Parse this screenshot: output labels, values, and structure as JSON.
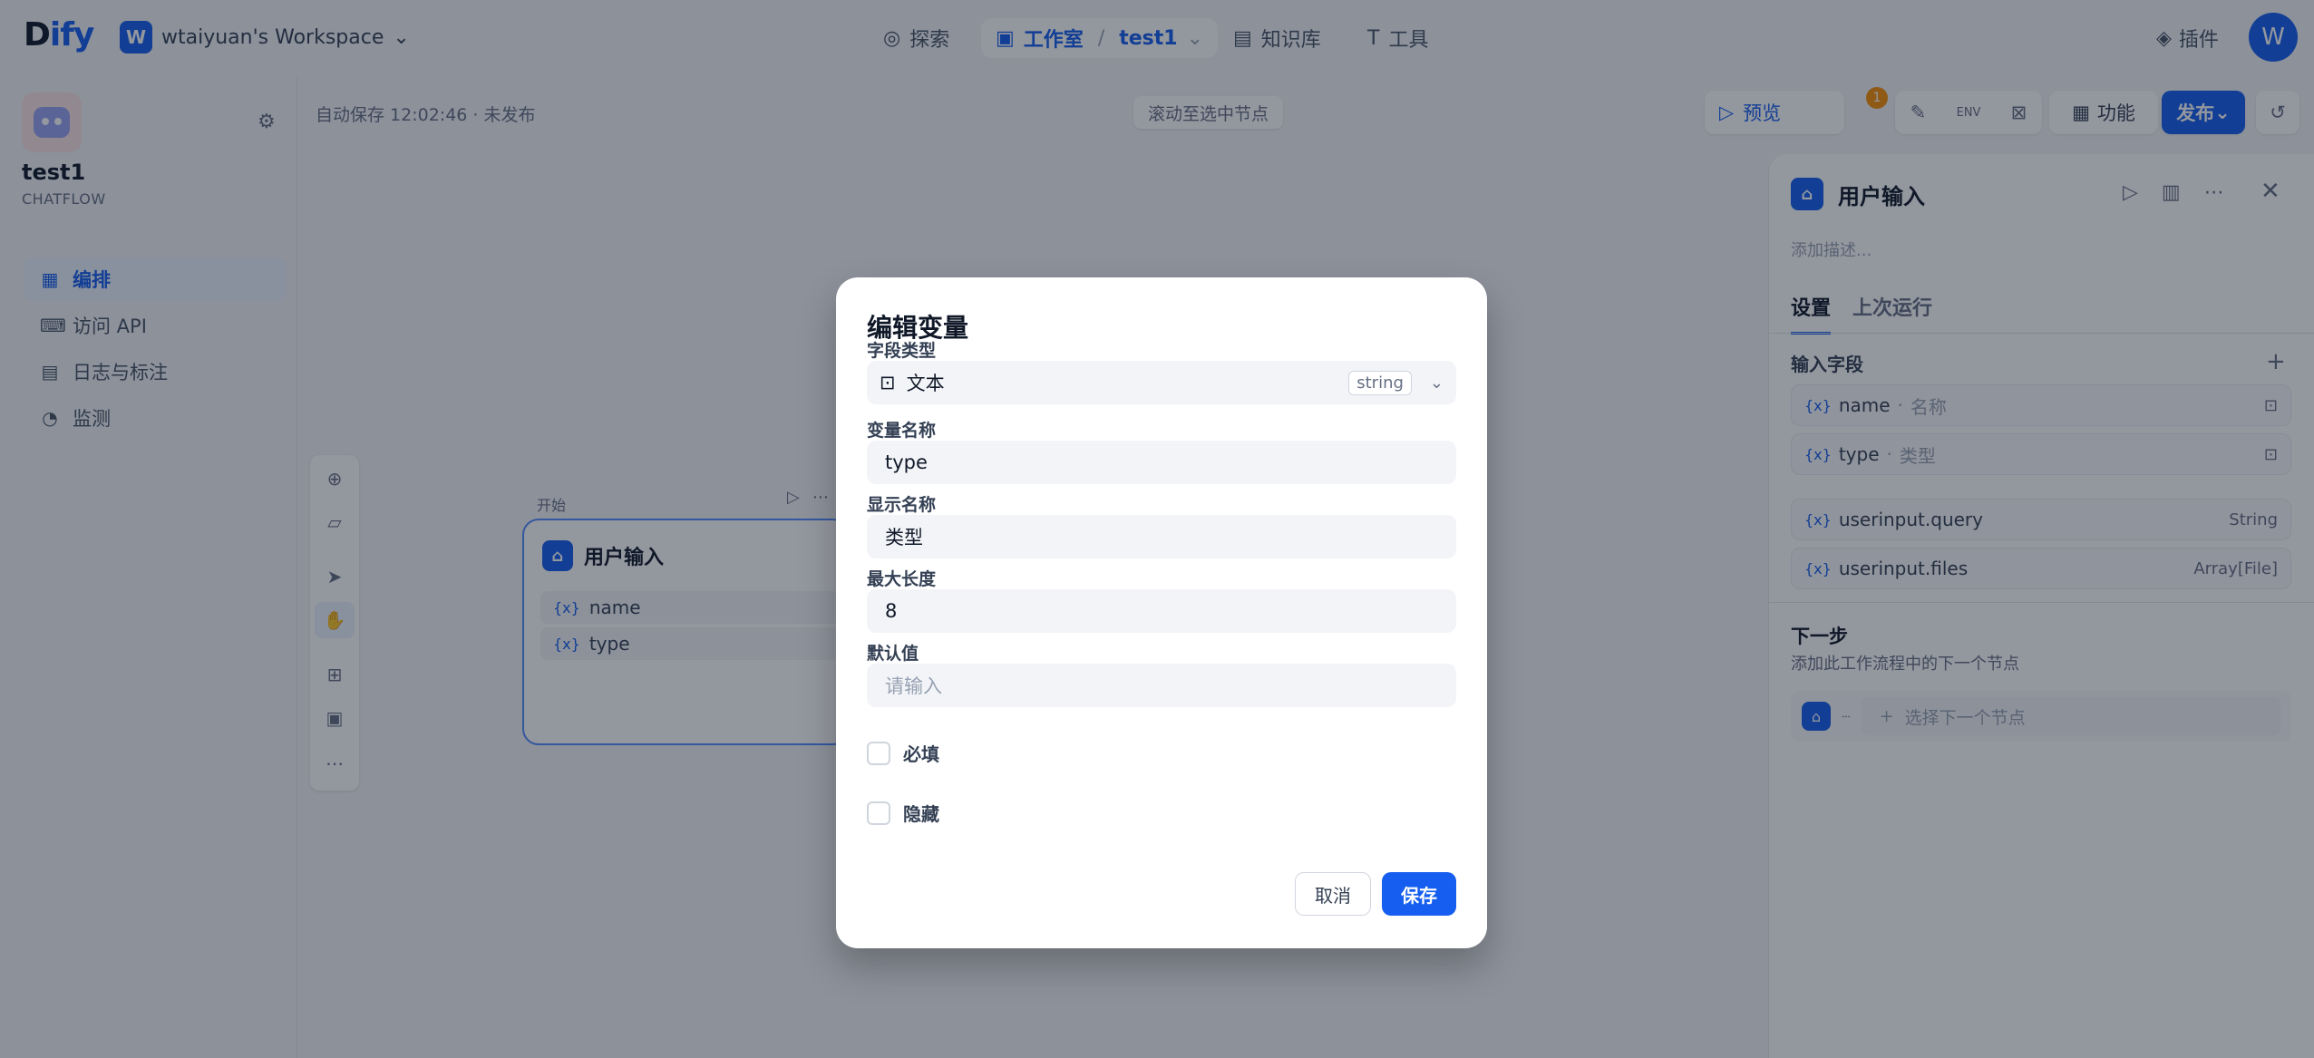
{
  "top": {
    "logo_d": "D",
    "logo_rest": "ify",
    "workspace_badge": "W",
    "workspace_name": "wtaiyuan's Workspace",
    "nav_explore": "探索",
    "nav_studio": "工作室",
    "nav_app": "test1",
    "nav_kb": "知识库",
    "nav_tools": "工具",
    "plugins": "插件",
    "avatar": "W"
  },
  "sidebar": {
    "app_name": "test1",
    "app_mode": "CHATFLOW",
    "items": [
      {
        "label": "编排",
        "icon": "layout-icon"
      },
      {
        "label": "访问 API",
        "icon": "terminal-icon"
      },
      {
        "label": "日志与标注",
        "icon": "file-list-icon"
      },
      {
        "label": "监测",
        "icon": "dashboard-icon"
      }
    ]
  },
  "canvas": {
    "autosave": "自动保存 12:02:46 · 未发布",
    "scroll_btn": "滚动至选中节点",
    "node_label": "开始",
    "node_title": "用户输入",
    "node_vars": [
      "name",
      "type"
    ]
  },
  "actions": {
    "preview": "预览",
    "notification_count": "1",
    "env": "ENV",
    "features": "功能",
    "publish": "发布"
  },
  "panel": {
    "title": "用户输入",
    "desc_placeholder": "添加描述...",
    "tab_settings": "设置",
    "tab_last_run": "上次运行",
    "input_fields_label": "输入字段",
    "fields": [
      {
        "name": "name",
        "label": "名称"
      },
      {
        "name": "type",
        "label": "类型"
      }
    ],
    "system_vars": [
      {
        "name": "userinput.query",
        "type": "String"
      },
      {
        "name": "userinput.files",
        "type": "Array[File]"
      }
    ],
    "next_title": "下一步",
    "next_desc": "添加此工作流程中的下一个节点",
    "next_select": "选择下一个节点"
  },
  "modal": {
    "title": "编辑变量",
    "field_type_label": "字段类型",
    "field_type_value": "文本",
    "field_type_tag": "string",
    "var_name_label": "变量名称",
    "var_name_value": "type",
    "display_name_label": "显示名称",
    "display_name_value": "类型",
    "max_length_label": "最大长度",
    "max_length_value": "8",
    "default_label": "默认值",
    "default_placeholder": "请输入",
    "required_label": "必填",
    "hidden_label": "隐藏",
    "cancel": "取消",
    "save": "保存"
  },
  "colors": {
    "accent": "#155eef",
    "background": "#f2f4f7",
    "badge": "#f79009"
  }
}
